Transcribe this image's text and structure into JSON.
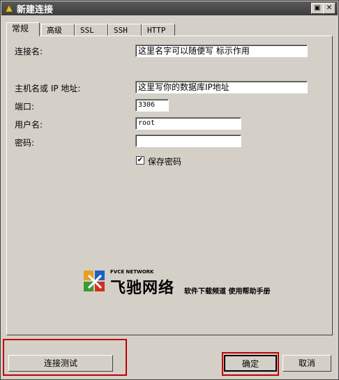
{
  "window": {
    "title": "新建连接",
    "restore_glyph": "▣",
    "close_glyph": "✕"
  },
  "tabs": [
    "常规",
    "高级",
    "SSL",
    "SSH",
    "HTTP"
  ],
  "fields": {
    "conn_name": {
      "label": "连接名:",
      "value": "这里名字可以随便写 标示作用"
    },
    "host": {
      "label": "主机名或 IP 地址:",
      "value": "这里写你的数据库IP地址"
    },
    "port": {
      "label": "端口:",
      "value": "3306"
    },
    "user": {
      "label": "用户名:",
      "value": "root"
    },
    "password": {
      "label": "密码:",
      "value": ""
    }
  },
  "save_password": {
    "label": "保存密码",
    "checked": true,
    "check_glyph": "✔"
  },
  "logo": {
    "network": "FVCE NETWORK",
    "brand": "飞驰网络",
    "slogan": "软件下载频道 使用帮助手册"
  },
  "buttons": {
    "test": "连接测试",
    "ok": "确定",
    "cancel": "取消"
  },
  "highlight_color": "#c00000"
}
